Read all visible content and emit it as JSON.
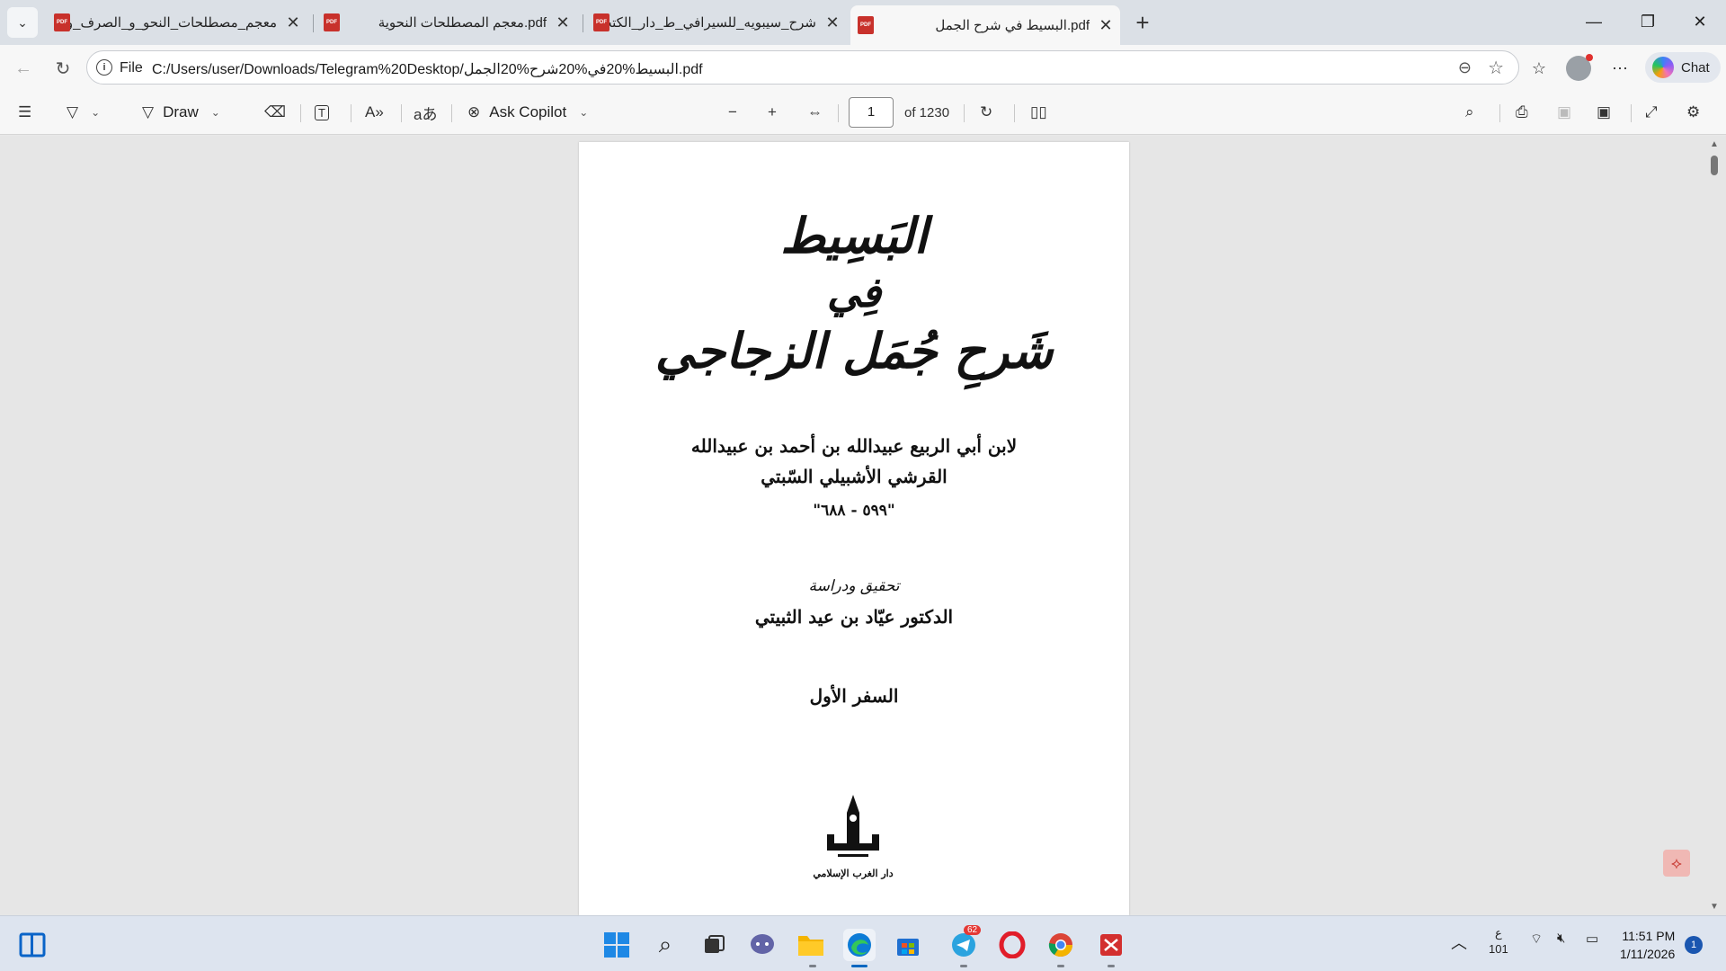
{
  "tabs": [
    {
      "title": "معجم_مصطلحات_النحو_و_الصرف_و",
      "pdf_badge": "PDF",
      "active": false
    },
    {
      "title": "pdf.معجم المصطلحات النحوية",
      "pdf_badge": "PDF",
      "active": false
    },
    {
      "title": "شرح_سيبويه_للسيرافي_ط_دار_الكتب",
      "pdf_badge": "PDF",
      "active": false
    },
    {
      "title": "pdf.البسيط في شرح الجمل",
      "pdf_badge": "PDF",
      "active": true
    }
  ],
  "address": {
    "scheme_label": "File",
    "url": "C:/Users/user/Downloads/Telegram%20Desktop/البسيط%20في%20شرح%20الجمل.pdf"
  },
  "chat_label": "Chat",
  "pdf_toolbar": {
    "draw_label": "Draw",
    "ask_copilot_label": "Ask Copilot",
    "page_number": "1",
    "page_total_label": "of 1230"
  },
  "document": {
    "title_line1": "البَسِيط",
    "title_line2": "فِي",
    "title_line3": "شَرحِ جُمَل الزجاجي",
    "author_line1": "لابن أبي الربيع عبيدالله بن أحمد بن عبيدالله",
    "author_line2": "القرشي الأشبيلي السّبتي",
    "dates": "\"٥٩٩ - ٦٨٨\"",
    "editor_caption": "تحقيق ودراسة",
    "editor_name": "الدكتور عيّاد بن عيد الثبيتي",
    "volume": "السفر الأول",
    "publisher_caption": "دار الغرب الإسلامي"
  },
  "taskbar": {
    "telegram_badge": "62",
    "lang_top": "ع",
    "lang_bottom": "101",
    "time": "11:51 PM",
    "date": "1/11/2026",
    "notification_count": "1"
  },
  "colors": {
    "tabstrip_bg": "#dbe0e6",
    "toolbar_bg": "#f7f7f7",
    "viewer_bg": "#e6e6e6",
    "pdf_red": "#c8312b",
    "taskbar_bg": "#dde4ef"
  }
}
